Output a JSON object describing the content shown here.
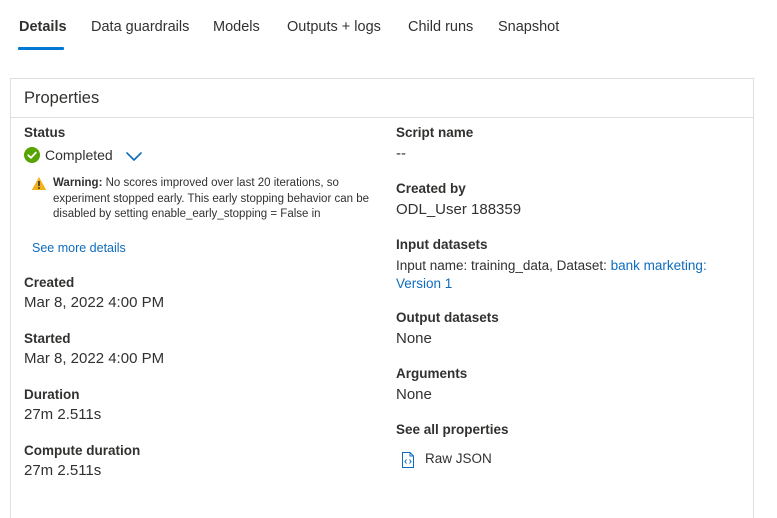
{
  "tabs": [
    {
      "label": "Details",
      "active": true
    },
    {
      "label": "Data guardrails"
    },
    {
      "label": "Models"
    },
    {
      "label": "Outputs + logs"
    },
    {
      "label": "Child runs"
    },
    {
      "label": "Snapshot"
    }
  ],
  "colors": {
    "accent": "#0078d4",
    "link": "#0f6cbd",
    "success": "#57a300",
    "warning": "#f2b01e"
  },
  "properties": {
    "title": "Properties",
    "left": {
      "status_label": "Status",
      "status_value": "Completed",
      "status_icon": "check-circle-icon",
      "warning_prefix": "Warning:",
      "warning_text": "No scores improved over last 20 iterations, so experiment stopped early. This early stopping behavior can be disabled by setting enable_early_stopping = False in",
      "see_more": "See more details",
      "created_label": "Created",
      "created_value": "Mar 8, 2022 4:00 PM",
      "started_label": "Started",
      "started_value": "Mar 8, 2022 4:00 PM",
      "duration_label": "Duration",
      "duration_value": "27m 2.511s",
      "compute_label": "Compute duration",
      "compute_value": "27m 2.511s"
    },
    "right": {
      "script_label": "Script name",
      "script_value": "--",
      "created_by_label": "Created by",
      "created_by_value": "ODL_User 188359",
      "input_label": "Input datasets",
      "input_prefix": "Input name: training_data, Dataset: ",
      "input_link": "bank marketing: Version 1",
      "output_label": "Output datasets",
      "output_value": "None",
      "arguments_label": "Arguments",
      "arguments_value": "None",
      "all_props_label": "See all properties",
      "raw_json": "Raw JSON"
    }
  }
}
